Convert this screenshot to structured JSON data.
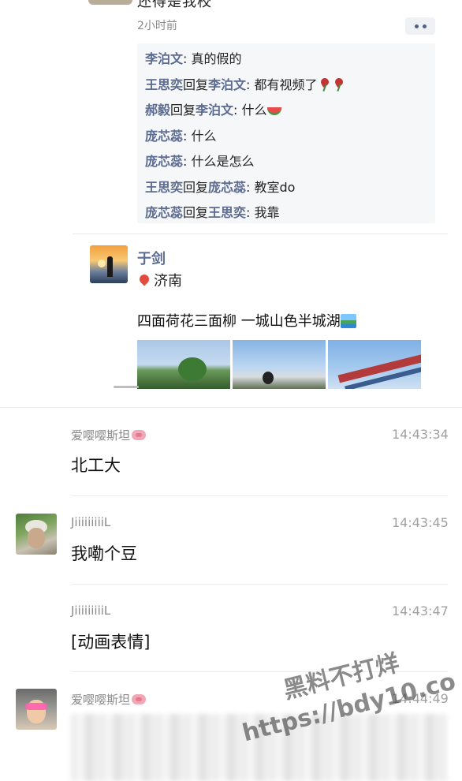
{
  "quoted_post": {
    "preview_text": "还得是我校",
    "time_ago": "2小时前",
    "more_label": "··",
    "comments": [
      {
        "name": "李泊文",
        "reply_word": "",
        "reply_to": "",
        "text": ": 真的假的"
      },
      {
        "name": "王思奕",
        "reply_word": "回复",
        "reply_to": "李泊文",
        "text": ": 都有视频了"
      },
      {
        "name": "郝毅",
        "reply_word": "回复",
        "reply_to": "李泊文",
        "text": ": 什么"
      },
      {
        "name": "庞芯蕊",
        "reply_word": "",
        "reply_to": "",
        "text": ": 什么"
      },
      {
        "name": "庞芯蕊",
        "reply_word": "",
        "reply_to": "",
        "text": ": 什么是怎么"
      },
      {
        "name": "王思奕",
        "reply_word": "回复",
        "reply_to": "庞芯蕊",
        "text": ": 教室do"
      },
      {
        "name": "庞芯蕊",
        "reply_word": "回复",
        "reply_to": "王思奕",
        "text": ": 我靠"
      }
    ]
  },
  "moment": {
    "author": "于剑",
    "location": "济南",
    "text": "四面荷花三面柳 一城山色半城湖",
    "photos": [
      "photo-lotus-park",
      "photo-person-sky",
      "photo-pavilion-roof"
    ]
  },
  "chat": [
    {
      "name": "爱嘤嘤斯坦",
      "time": "14:43:34",
      "body": "北工大"
    },
    {
      "name": "JiiiiiiiiiL",
      "time": "14:43:45",
      "body": "我嘞个豆"
    },
    {
      "name": "JiiiiiiiiiL",
      "time": "14:43:47",
      "body": "[动画表情]"
    },
    {
      "name": "爱嘤嘤斯坦",
      "time": "14:44:49",
      "body": ""
    }
  ],
  "watermark": {
    "line1": "黑料不打烊",
    "line2": "https://bdy10.co"
  },
  "colors": {
    "name_blue": "#5b6b91",
    "time_gray": "#a0a0a0",
    "comment_bg": "#f6f7f8"
  }
}
